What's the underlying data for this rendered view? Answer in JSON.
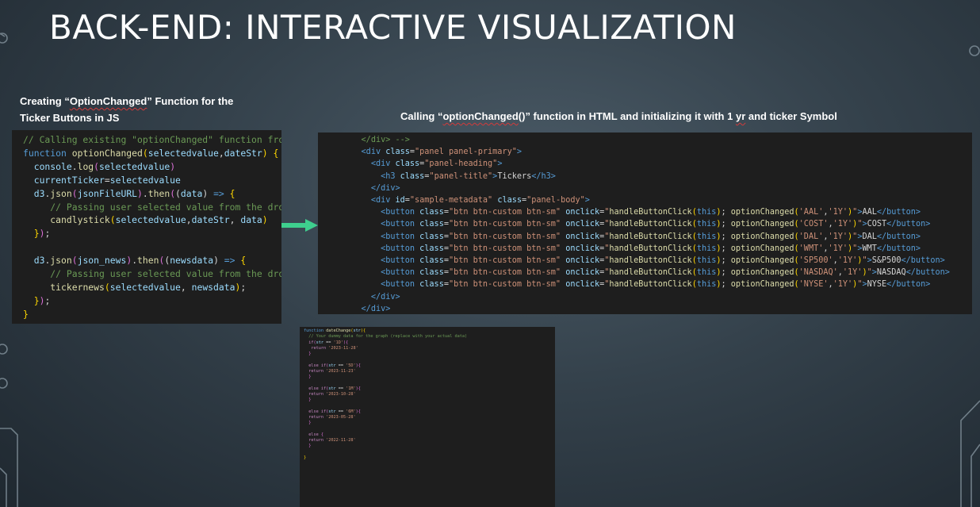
{
  "title": "BACK-END: INTERACTIVE VISUALIZATION",
  "captions": {
    "left_line1_pre": "Creating “",
    "left_line1_word": "OptionChanged",
    "left_line1_post": "” Function for the",
    "left_line2": "Ticker Buttons in JS",
    "right_pre": "Calling “",
    "right_word": "optionChanged",
    "right_mid": "()” function in HTML and initializing it with 1 ",
    "right_word2": "yr",
    "right_post": " and ticker Symbol"
  },
  "js_code": [
    [
      [
        "c",
        "// Calling existing \"optionChanged\" function from"
      ]
    ],
    [
      [
        "k",
        "function "
      ],
      [
        "fn",
        "optionChanged"
      ],
      [
        "br",
        "("
      ],
      [
        "v",
        "selectedvalue"
      ],
      [
        "p",
        ","
      ],
      [
        "v",
        "dateStr"
      ],
      [
        "br",
        ")"
      ],
      [
        "p",
        " "
      ],
      [
        "br",
        "{"
      ]
    ],
    [
      [
        "p",
        "  "
      ],
      [
        "v",
        "console"
      ],
      [
        "p",
        "."
      ],
      [
        "fn",
        "log"
      ],
      [
        "br2",
        "("
      ],
      [
        "v",
        "selectedvalue"
      ],
      [
        "br2",
        ")"
      ]
    ],
    [
      [
        "p",
        "  "
      ],
      [
        "v",
        "currentTicker"
      ],
      [
        "p",
        "="
      ],
      [
        "v",
        "selectedvalue"
      ]
    ],
    [
      [
        "p",
        "  "
      ],
      [
        "v",
        "d3"
      ],
      [
        "p",
        "."
      ],
      [
        "fn",
        "json"
      ],
      [
        "br2",
        "("
      ],
      [
        "v",
        "jsonFileURL"
      ],
      [
        "br2",
        ")"
      ],
      [
        "p",
        "."
      ],
      [
        "fn",
        "then"
      ],
      [
        "br2",
        "("
      ],
      [
        "p",
        "("
      ],
      [
        "v",
        "data"
      ],
      [
        "p",
        ") "
      ],
      [
        "k",
        "=>"
      ],
      [
        "p",
        " "
      ],
      [
        "br",
        "{"
      ]
    ],
    [
      [
        "p",
        "     "
      ],
      [
        "c",
        "// Passing user selected value from the dro"
      ]
    ],
    [
      [
        "p",
        "     "
      ],
      [
        "fn",
        "candlystick"
      ],
      [
        "br",
        "("
      ],
      [
        "v",
        "selectedvalue"
      ],
      [
        "p",
        ","
      ],
      [
        "v",
        "dateStr"
      ],
      [
        "p",
        ", "
      ],
      [
        "v",
        "data"
      ],
      [
        "br",
        ")"
      ]
    ],
    [
      [
        "p",
        "  "
      ],
      [
        "br",
        "}"
      ],
      [
        "br2",
        ")"
      ],
      [
        "p",
        ";"
      ]
    ],
    [
      [
        "p",
        ""
      ]
    ],
    [
      [
        "p",
        "  "
      ],
      [
        "v",
        "d3"
      ],
      [
        "p",
        "."
      ],
      [
        "fn",
        "json"
      ],
      [
        "br2",
        "("
      ],
      [
        "v",
        "json_news"
      ],
      [
        "br2",
        ")"
      ],
      [
        "p",
        "."
      ],
      [
        "fn",
        "then"
      ],
      [
        "br2",
        "("
      ],
      [
        "p",
        "("
      ],
      [
        "v",
        "newsdata"
      ],
      [
        "p",
        ") "
      ],
      [
        "k",
        "=>"
      ],
      [
        "p",
        " "
      ],
      [
        "br",
        "{"
      ]
    ],
    [
      [
        "p",
        "     "
      ],
      [
        "c",
        "// Passing user selected value from the dro"
      ]
    ],
    [
      [
        "p",
        "     "
      ],
      [
        "fn",
        "tickernews"
      ],
      [
        "br",
        "("
      ],
      [
        "v",
        "selectedvalue"
      ],
      [
        "p",
        ", "
      ],
      [
        "v",
        "newsdata"
      ],
      [
        "br",
        ")"
      ],
      [
        "p",
        ";"
      ]
    ],
    [
      [
        "p",
        "  "
      ],
      [
        "br",
        "}"
      ],
      [
        "br2",
        ")"
      ],
      [
        "p",
        ";"
      ]
    ],
    [
      [
        "br",
        "}"
      ]
    ]
  ],
  "html_code": [
    [
      [
        "p",
        "    "
      ],
      [
        "c",
        "</div> -->"
      ]
    ],
    [
      [
        "p",
        "    "
      ],
      [
        "tag",
        "<div "
      ],
      [
        "at",
        "class"
      ],
      [
        "p",
        "="
      ],
      [
        "s",
        "\"panel panel-primary\""
      ],
      [
        "tag",
        ">"
      ]
    ],
    [
      [
        "p",
        "      "
      ],
      [
        "tag",
        "<div "
      ],
      [
        "at",
        "class"
      ],
      [
        "p",
        "="
      ],
      [
        "s",
        "\"panel-heading\""
      ],
      [
        "tag",
        ">"
      ]
    ],
    [
      [
        "p",
        "        "
      ],
      [
        "tag",
        "<h3 "
      ],
      [
        "at",
        "class"
      ],
      [
        "p",
        "="
      ],
      [
        "s",
        "\"panel-title\""
      ],
      [
        "tag",
        ">"
      ],
      [
        "p",
        "Tickers"
      ],
      [
        "tag",
        "</h3>"
      ]
    ],
    [
      [
        "p",
        "      "
      ],
      [
        "tag",
        "</div>"
      ]
    ],
    [
      [
        "p",
        "      "
      ],
      [
        "tag",
        "<div "
      ],
      [
        "at",
        "id"
      ],
      [
        "p",
        "="
      ],
      [
        "s",
        "\"sample-metadata\""
      ],
      [
        "p",
        " "
      ],
      [
        "at",
        "class"
      ],
      [
        "p",
        "="
      ],
      [
        "s",
        "\"panel-body\""
      ],
      [
        "tag",
        ">"
      ]
    ],
    [
      [
        "p",
        "        "
      ],
      [
        "tag",
        "<button "
      ],
      [
        "at",
        "class"
      ],
      [
        "p",
        "="
      ],
      [
        "s",
        "\"btn btn-custom btn-sm\""
      ],
      [
        "p",
        " "
      ],
      [
        "at",
        "onclick"
      ],
      [
        "p",
        "="
      ],
      [
        "s",
        "\""
      ],
      [
        "fn",
        "handleButtonClick"
      ],
      [
        "br",
        "("
      ],
      [
        "k",
        "this"
      ],
      [
        "br",
        ")"
      ],
      [
        "p",
        "; "
      ],
      [
        "fn",
        "optionChanged"
      ],
      [
        "br",
        "("
      ],
      [
        "s",
        "'AAL'"
      ],
      [
        "p",
        ","
      ],
      [
        "s",
        "'1Y'"
      ],
      [
        "br",
        ")"
      ],
      [
        "s",
        "\""
      ],
      [
        "tag",
        ">"
      ],
      [
        "p",
        "AAL"
      ],
      [
        "tag",
        "</button>"
      ]
    ],
    [
      [
        "p",
        "        "
      ],
      [
        "tag",
        "<button "
      ],
      [
        "at",
        "class"
      ],
      [
        "p",
        "="
      ],
      [
        "s",
        "\"btn btn-custom btn-sm\""
      ],
      [
        "p",
        " "
      ],
      [
        "at",
        "onclick"
      ],
      [
        "p",
        "="
      ],
      [
        "s",
        "\""
      ],
      [
        "fn",
        "handleButtonClick"
      ],
      [
        "br",
        "("
      ],
      [
        "k",
        "this"
      ],
      [
        "br",
        ")"
      ],
      [
        "p",
        "; "
      ],
      [
        "fn",
        "optionChanged"
      ],
      [
        "br",
        "("
      ],
      [
        "s",
        "'COST'"
      ],
      [
        "p",
        ","
      ],
      [
        "s",
        "'1Y'"
      ],
      [
        "br",
        ")"
      ],
      [
        "s",
        "\""
      ],
      [
        "tag",
        ">"
      ],
      [
        "p",
        "COST"
      ],
      [
        "tag",
        "</button>"
      ]
    ],
    [
      [
        "p",
        "        "
      ],
      [
        "tag",
        "<button "
      ],
      [
        "at",
        "class"
      ],
      [
        "p",
        "="
      ],
      [
        "s",
        "\"btn btn-custom btn-sm\""
      ],
      [
        "p",
        " "
      ],
      [
        "at",
        "onclick"
      ],
      [
        "p",
        "="
      ],
      [
        "s",
        "\""
      ],
      [
        "fn",
        "handleButtonClick"
      ],
      [
        "br",
        "("
      ],
      [
        "k",
        "this"
      ],
      [
        "br",
        ")"
      ],
      [
        "p",
        "; "
      ],
      [
        "fn",
        "optionChanged"
      ],
      [
        "br",
        "("
      ],
      [
        "s",
        "'DAL'"
      ],
      [
        "p",
        ","
      ],
      [
        "s",
        "'1Y'"
      ],
      [
        "br",
        ")"
      ],
      [
        "s",
        "\""
      ],
      [
        "tag",
        ">"
      ],
      [
        "p",
        "DAL"
      ],
      [
        "tag",
        "</button>"
      ]
    ],
    [
      [
        "p",
        "        "
      ],
      [
        "tag",
        "<button "
      ],
      [
        "at",
        "class"
      ],
      [
        "p",
        "="
      ],
      [
        "s",
        "\"btn btn-custom btn-sm\""
      ],
      [
        "p",
        " "
      ],
      [
        "at",
        "onclick"
      ],
      [
        "p",
        "="
      ],
      [
        "s",
        "\""
      ],
      [
        "fn",
        "handleButtonClick"
      ],
      [
        "br",
        "("
      ],
      [
        "k",
        "this"
      ],
      [
        "br",
        ")"
      ],
      [
        "p",
        "; "
      ],
      [
        "fn",
        "optionChanged"
      ],
      [
        "br",
        "("
      ],
      [
        "s",
        "'WMT'"
      ],
      [
        "p",
        ","
      ],
      [
        "s",
        "'1Y'"
      ],
      [
        "br",
        ")"
      ],
      [
        "s",
        "\""
      ],
      [
        "tag",
        ">"
      ],
      [
        "p",
        "WMT"
      ],
      [
        "tag",
        "</button>"
      ]
    ],
    [
      [
        "p",
        "        "
      ],
      [
        "tag",
        "<button "
      ],
      [
        "at",
        "class"
      ],
      [
        "p",
        "="
      ],
      [
        "s",
        "\"btn btn-custom btn-sm\""
      ],
      [
        "p",
        " "
      ],
      [
        "at",
        "onclick"
      ],
      [
        "p",
        "="
      ],
      [
        "s",
        "\""
      ],
      [
        "fn",
        "handleButtonClick"
      ],
      [
        "br",
        "("
      ],
      [
        "k",
        "this"
      ],
      [
        "br",
        ")"
      ],
      [
        "p",
        "; "
      ],
      [
        "fn",
        "optionChanged"
      ],
      [
        "br",
        "("
      ],
      [
        "s",
        "'SP500'"
      ],
      [
        "p",
        ","
      ],
      [
        "s",
        "'1Y'"
      ],
      [
        "br",
        ")"
      ],
      [
        "s",
        "\""
      ],
      [
        "tag",
        ">"
      ],
      [
        "p",
        "S&P500"
      ],
      [
        "tag",
        "</button>"
      ]
    ],
    [
      [
        "p",
        "        "
      ],
      [
        "tag",
        "<button "
      ],
      [
        "at",
        "class"
      ],
      [
        "p",
        "="
      ],
      [
        "s",
        "\"btn btn-custom btn-sm\""
      ],
      [
        "p",
        " "
      ],
      [
        "at",
        "onclick"
      ],
      [
        "p",
        "="
      ],
      [
        "s",
        "\""
      ],
      [
        "fn",
        "handleButtonClick"
      ],
      [
        "br",
        "("
      ],
      [
        "k",
        "this"
      ],
      [
        "br",
        ")"
      ],
      [
        "p",
        "; "
      ],
      [
        "fn",
        "optionChanged"
      ],
      [
        "br",
        "("
      ],
      [
        "s",
        "'NASDAQ'"
      ],
      [
        "p",
        ","
      ],
      [
        "s",
        "'1Y'"
      ],
      [
        "br",
        ")"
      ],
      [
        "s",
        "\""
      ],
      [
        "tag",
        ">"
      ],
      [
        "p",
        "NASDAQ"
      ],
      [
        "tag",
        "</button>"
      ]
    ],
    [
      [
        "p",
        "        "
      ],
      [
        "tag",
        "<button "
      ],
      [
        "at",
        "class"
      ],
      [
        "p",
        "="
      ],
      [
        "s",
        "\"btn btn-custom btn-sm\""
      ],
      [
        "p",
        " "
      ],
      [
        "at",
        "onclick"
      ],
      [
        "p",
        "="
      ],
      [
        "s",
        "\""
      ],
      [
        "fn",
        "handleButtonClick"
      ],
      [
        "br",
        "("
      ],
      [
        "k",
        "this"
      ],
      [
        "br",
        ")"
      ],
      [
        "p",
        "; "
      ],
      [
        "fn",
        "optionChanged"
      ],
      [
        "br",
        "("
      ],
      [
        "s",
        "'NYSE'"
      ],
      [
        "p",
        ","
      ],
      [
        "s",
        "'1Y'"
      ],
      [
        "br",
        ")"
      ],
      [
        "s",
        "\""
      ],
      [
        "tag",
        ">"
      ],
      [
        "p",
        "NYSE"
      ],
      [
        "tag",
        "</button>"
      ]
    ],
    [
      [
        "p",
        "      "
      ],
      [
        "tag",
        "</div>"
      ]
    ],
    [
      [
        "p",
        "    "
      ],
      [
        "tag",
        "</div>"
      ]
    ]
  ],
  "date_code": [
    [
      [
        "k",
        "function "
      ],
      [
        "fn",
        "dateChange"
      ],
      [
        "br",
        "("
      ],
      [
        "v",
        "str"
      ],
      [
        "br",
        ")"
      ],
      [
        "br",
        "{"
      ]
    ],
    [
      [
        "p",
        "  "
      ],
      [
        "c",
        "// Your dummy data for the graph (replace with your actual data)"
      ]
    ],
    [
      [
        "p",
        "  "
      ],
      [
        "kw",
        "if"
      ],
      [
        "br2",
        "("
      ],
      [
        "v",
        "str"
      ],
      [
        "p",
        " == "
      ],
      [
        "s",
        "'1D'"
      ],
      [
        "br2",
        ")"
      ],
      [
        "br2",
        "{"
      ]
    ],
    [
      [
        "p",
        "   "
      ],
      [
        "kw",
        "return "
      ],
      [
        "s",
        "'2023-11-28'"
      ]
    ],
    [
      [
        "p",
        "  "
      ],
      [
        "br2",
        "}"
      ]
    ],
    [
      [
        "p",
        ""
      ]
    ],
    [
      [
        "p",
        "  "
      ],
      [
        "kw",
        "else if"
      ],
      [
        "br2",
        "("
      ],
      [
        "v",
        "str"
      ],
      [
        "p",
        " == "
      ],
      [
        "s",
        "'5D'"
      ],
      [
        "br2",
        ")"
      ],
      [
        "br2",
        "{"
      ]
    ],
    [
      [
        "p",
        "  "
      ],
      [
        "kw",
        "return "
      ],
      [
        "s",
        "'2023-11-23'"
      ]
    ],
    [
      [
        "p",
        "  "
      ],
      [
        "br2",
        "}"
      ]
    ],
    [
      [
        "p",
        ""
      ]
    ],
    [
      [
        "p",
        "  "
      ],
      [
        "kw",
        "else if"
      ],
      [
        "br2",
        "("
      ],
      [
        "v",
        "str"
      ],
      [
        "p",
        " == "
      ],
      [
        "s",
        "'1M'"
      ],
      [
        "br2",
        ")"
      ],
      [
        "br2",
        "{"
      ]
    ],
    [
      [
        "p",
        "  "
      ],
      [
        "kw",
        "return "
      ],
      [
        "s",
        "'2023-10-28'"
      ]
    ],
    [
      [
        "p",
        "  "
      ],
      [
        "br2",
        "}"
      ]
    ],
    [
      [
        "p",
        ""
      ]
    ],
    [
      [
        "p",
        "  "
      ],
      [
        "kw",
        "else if"
      ],
      [
        "br2",
        "("
      ],
      [
        "v",
        "str"
      ],
      [
        "p",
        " == "
      ],
      [
        "s",
        "'6M'"
      ],
      [
        "br2",
        ")"
      ],
      [
        "br2",
        "{"
      ]
    ],
    [
      [
        "p",
        "  "
      ],
      [
        "kw",
        "return "
      ],
      [
        "s",
        "'2023-05-28'"
      ]
    ],
    [
      [
        "p",
        "  "
      ],
      [
        "br2",
        "}"
      ]
    ],
    [
      [
        "p",
        ""
      ]
    ],
    [
      [
        "p",
        "  "
      ],
      [
        "kw",
        "else "
      ],
      [
        "br2",
        "{"
      ]
    ],
    [
      [
        "p",
        "  "
      ],
      [
        "kw",
        "return "
      ],
      [
        "s",
        "'2022-11-28'"
      ]
    ],
    [
      [
        "p",
        "  "
      ],
      [
        "br2",
        "}"
      ]
    ],
    [
      [
        "p",
        ""
      ]
    ],
    [
      [
        "br",
        "}"
      ]
    ]
  ],
  "colors": {
    "c": "#6a9955",
    "k": "#569cd6",
    "kw": "#c586c0",
    "fn": "#dcdcaa",
    "v": "#9cdcfe",
    "s": "#ce9178",
    "p": "#d4d4d4",
    "br": "#ffd700",
    "br2": "#da70d6",
    "tag": "#569cd6",
    "at": "#9cdcfe",
    "arrow": "#3ecf8e"
  }
}
